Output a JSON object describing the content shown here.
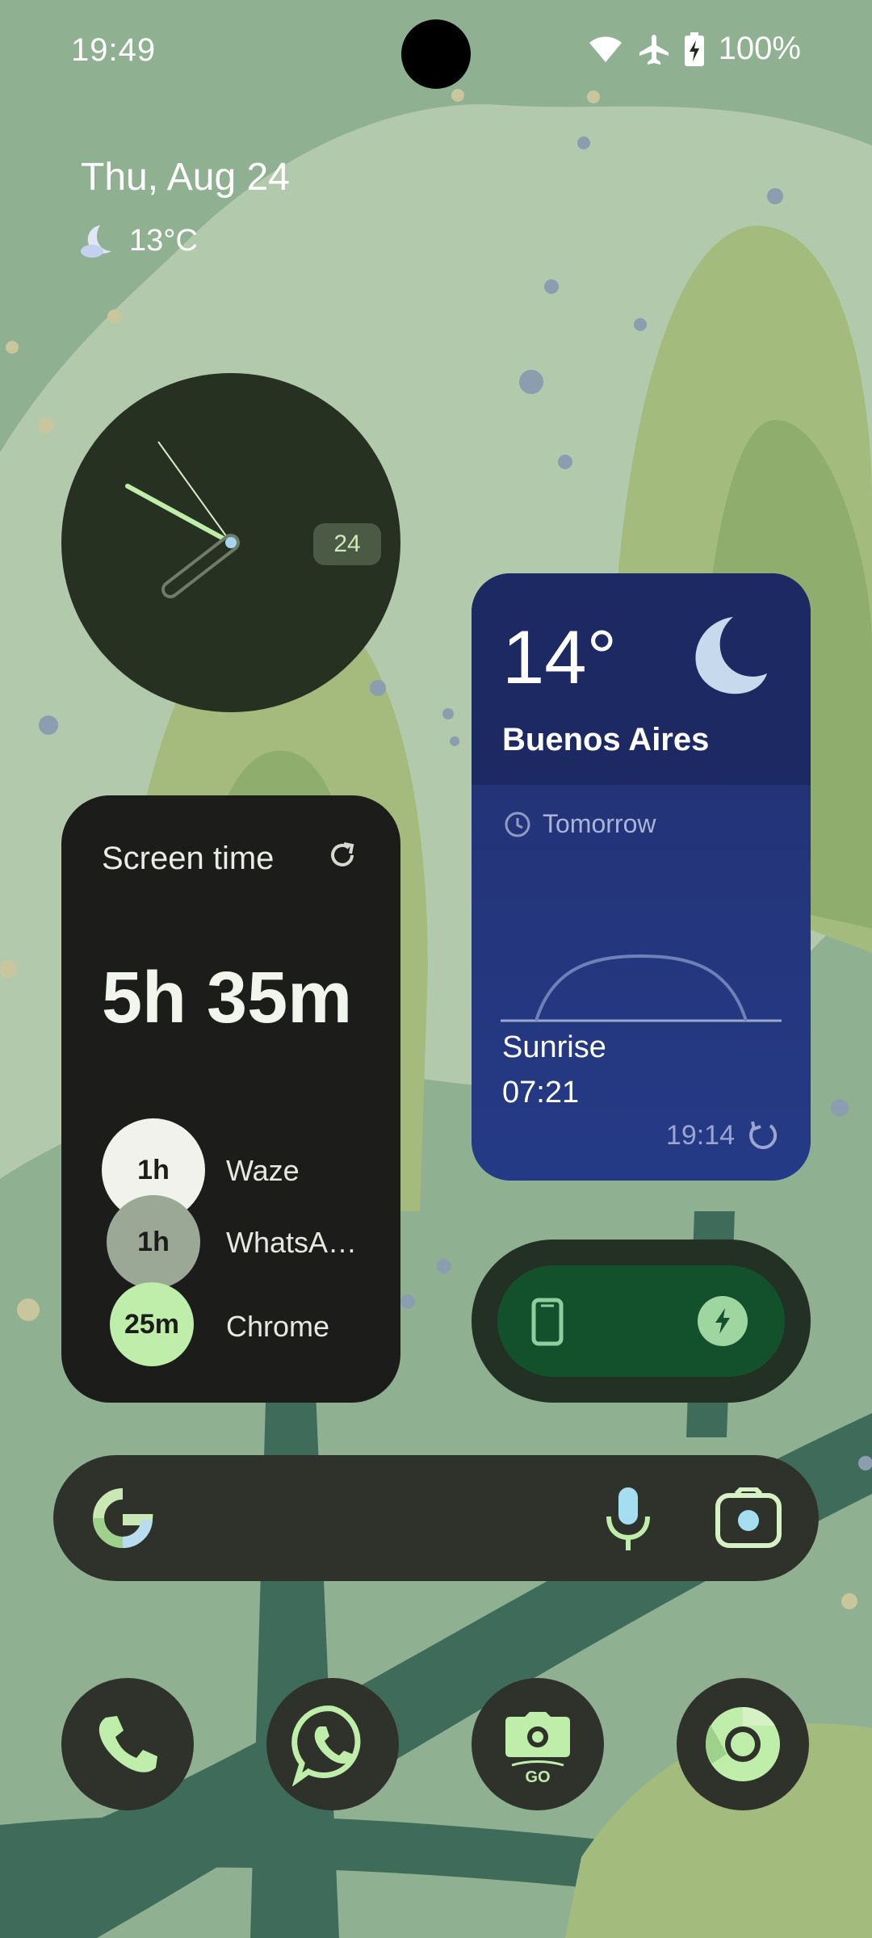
{
  "status_bar": {
    "time": "19:49",
    "battery_percent": "100%",
    "icons": [
      "wifi-icon",
      "airplane-icon",
      "battery-charging-icon"
    ]
  },
  "glance": {
    "date": "Thu, Aug 24",
    "weather_icon": "moon-cloud-icon",
    "temperature": "13°C"
  },
  "clock_widget": {
    "date_badge": "24"
  },
  "weather_widget": {
    "temperature": "14°",
    "city": "Buenos Aires",
    "condition_icon": "moon-icon",
    "forecast_label": "Tomorrow",
    "event_label": "Sunrise",
    "event_time": "07:21",
    "updated_time": "19:14"
  },
  "screen_time": {
    "title": "Screen time",
    "total": "5h 35m",
    "apps": [
      {
        "duration": "1h",
        "name": "Waze",
        "color": "#f1f2ec"
      },
      {
        "duration": "1h",
        "name": "WhatsA…",
        "color": "#9aa895"
      },
      {
        "duration": "25m",
        "name": "Chrome",
        "color": "#bfeeab"
      }
    ]
  },
  "battery_widget": {
    "device_icon": "phone-icon",
    "status_icon": "charging-bolt-icon"
  },
  "search_bar": {
    "logo": "google-g-icon",
    "icons": [
      "microphone-icon",
      "google-lens-icon"
    ]
  },
  "dock": {
    "apps": [
      "phone-app-icon",
      "whatsapp-app-icon",
      "camera-go-app-icon",
      "chrome-app-icon"
    ],
    "camera_label": "GO"
  },
  "colors": {
    "wallpaper": "#8fb191",
    "widget_dark": "#263122",
    "weather_bg": "#243479",
    "accent_green": "#bfeeab"
  }
}
